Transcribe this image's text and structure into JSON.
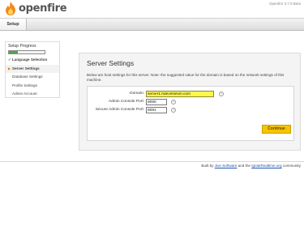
{
  "header": {
    "logo_text": "openfire",
    "version": "Openfire 3.7.0 Beta"
  },
  "nav": {
    "tabs": [
      {
        "label": "Setup"
      }
    ]
  },
  "sidebar": {
    "title": "Setup Progress",
    "progress_fraction": 0.25,
    "items": [
      {
        "label": "Language Selection",
        "state": "done"
      },
      {
        "label": "Server Settings",
        "state": "active"
      },
      {
        "label": "Database Settings",
        "state": "pending"
      },
      {
        "label": "Profile Settings",
        "state": "pending"
      },
      {
        "label": "Admin Account",
        "state": "pending"
      }
    ]
  },
  "main": {
    "title": "Server Settings",
    "description": "Below are host settings for this server. Note: the suggested value for the domain is based on the network settings of this machine.",
    "fields": [
      {
        "label": "Domain:",
        "value": "server1.hdevinsevin.com"
      },
      {
        "label": "Admin Console Port:",
        "value": "9090"
      },
      {
        "label": "Secure Admin Console Port:",
        "value": "9091"
      }
    ],
    "help_glyph": "?",
    "continue_label": "Continue"
  },
  "footer": {
    "prefix": "Built by ",
    "link1": "Jive Software",
    "middle": " and the ",
    "link2": "IgniteRealtime.org",
    "suffix": " community"
  },
  "colors": {
    "highlight": "#fff84a",
    "button": "#f5c400",
    "progress": "#4ea64e",
    "link": "#2255aa"
  }
}
